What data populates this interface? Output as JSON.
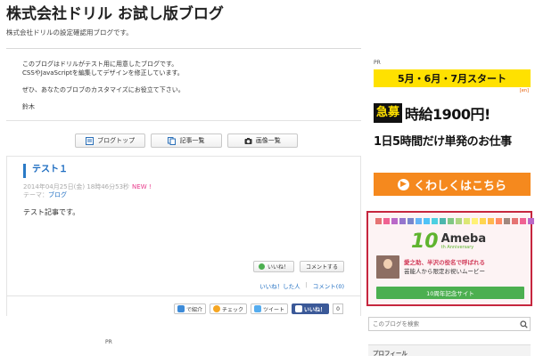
{
  "header": {
    "title": "株式会社ドリル お試し版ブログ",
    "description": "株式会社ドリルの設定確認用ブログです。"
  },
  "intro": {
    "line1": "このブログはドリルがテスト用に用意したブログです。",
    "line2": "CSSやJavaScriptを編集してデザインを修正しています。",
    "line3": "ぜひ、あなたのブロブのカスタマイズにお役立て下さい。",
    "signature": "鈴木"
  },
  "nav": {
    "top": "ブログトップ",
    "list": "記事一覧",
    "images": "画像一覧"
  },
  "article": {
    "title": "テスト１",
    "date": "2014年04月25日(金) 18時46分53秒",
    "new_badge": "NEW !",
    "theme_label": "テーマ：",
    "theme_value": "ブログ",
    "body": "テスト記事です。",
    "like_button": "いいね！",
    "comment_button": "コメントする",
    "liked_link": "いいね！した人",
    "separator": "|",
    "comment_link": "コメント(0)"
  },
  "share": {
    "intro": "で紹介",
    "check": "チェック",
    "tweet": "ツイート",
    "fb_like": "いいね！",
    "fb_count": "0"
  },
  "pr_bottom": "PR",
  "sidebar": {
    "pr": "PR",
    "ad1": {
      "headline": "5月・6月・7月スタート",
      "en": "[en]",
      "urgent": "急募",
      "pay": "時給1900円!",
      "sub": "1日5時間だけ単発のお仕事",
      "cta": "くわしくはこちら",
      "cta_arrow": "▶"
    },
    "ad2": {
      "ten": "10",
      "ameba": "Ameba",
      "anniversary": "th Anniversary",
      "text_hl": "愛之助、半沢の役名で呼ばれる",
      "text2": "芸能人から限定お祝いムービー",
      "button": "10周年記念サイト"
    },
    "search_placeholder": "このブログを検索",
    "profile": "プロフィール"
  },
  "colors": {
    "accent_blue": "#1c6cc1",
    "ad_yellow": "#ffe100",
    "ad_orange": "#f5891e",
    "ameba_green": "#5fb42f",
    "ad_border": "#c6263e",
    "new_pink": "#e83a8b"
  }
}
